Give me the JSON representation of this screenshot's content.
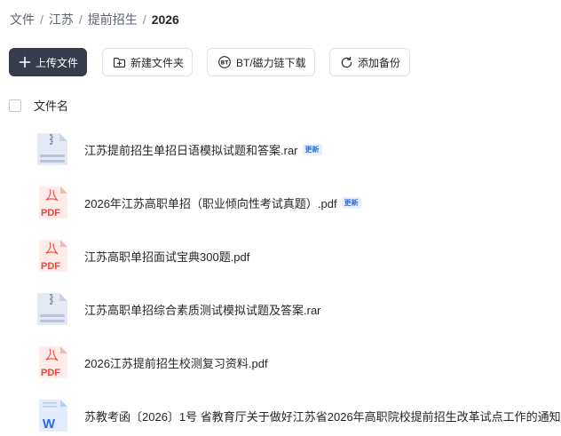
{
  "breadcrumb": {
    "items": [
      "文件",
      "江苏",
      "提前招生"
    ],
    "current": "2026",
    "separator": "/"
  },
  "toolbar": {
    "upload_label": "上传文件",
    "new_folder_label": "新建文件夹",
    "bt_download_label": "BT/磁力链下载",
    "add_backup_label": "添加备份"
  },
  "list_header": {
    "name_label": "文件名"
  },
  "files": [
    {
      "name": "江苏提前招生单招日语模拟试题和答案.rar",
      "type": "rar",
      "badge": "更新"
    },
    {
      "name": "2026年江苏高职单招（职业倾向性考试真题）.pdf",
      "type": "pdf",
      "badge": "更新"
    },
    {
      "name": "江苏高职单招面试宝典300题.pdf",
      "type": "pdf",
      "badge": ""
    },
    {
      "name": "江苏高职单招综合素质测试模拟试题及答案.rar",
      "type": "rar",
      "badge": ""
    },
    {
      "name": "2026江苏提前招生校测复习资料.pdf",
      "type": "pdf",
      "badge": ""
    },
    {
      "name": "苏教考函〔2026〕1号 省教育厅关于做好江苏省2026年高职院校提前招生改革试点工作的通知",
      "type": "word",
      "badge": ""
    }
  ],
  "icons": {
    "pdf_label": "PDF",
    "word_label": "W"
  },
  "colors": {
    "primary_button": "#373c4b",
    "pdf_red": "#e5483c",
    "word_blue": "#2b6de4",
    "archive_grey": "#b9c2d6",
    "badge_blue": "#2f6bd6"
  }
}
